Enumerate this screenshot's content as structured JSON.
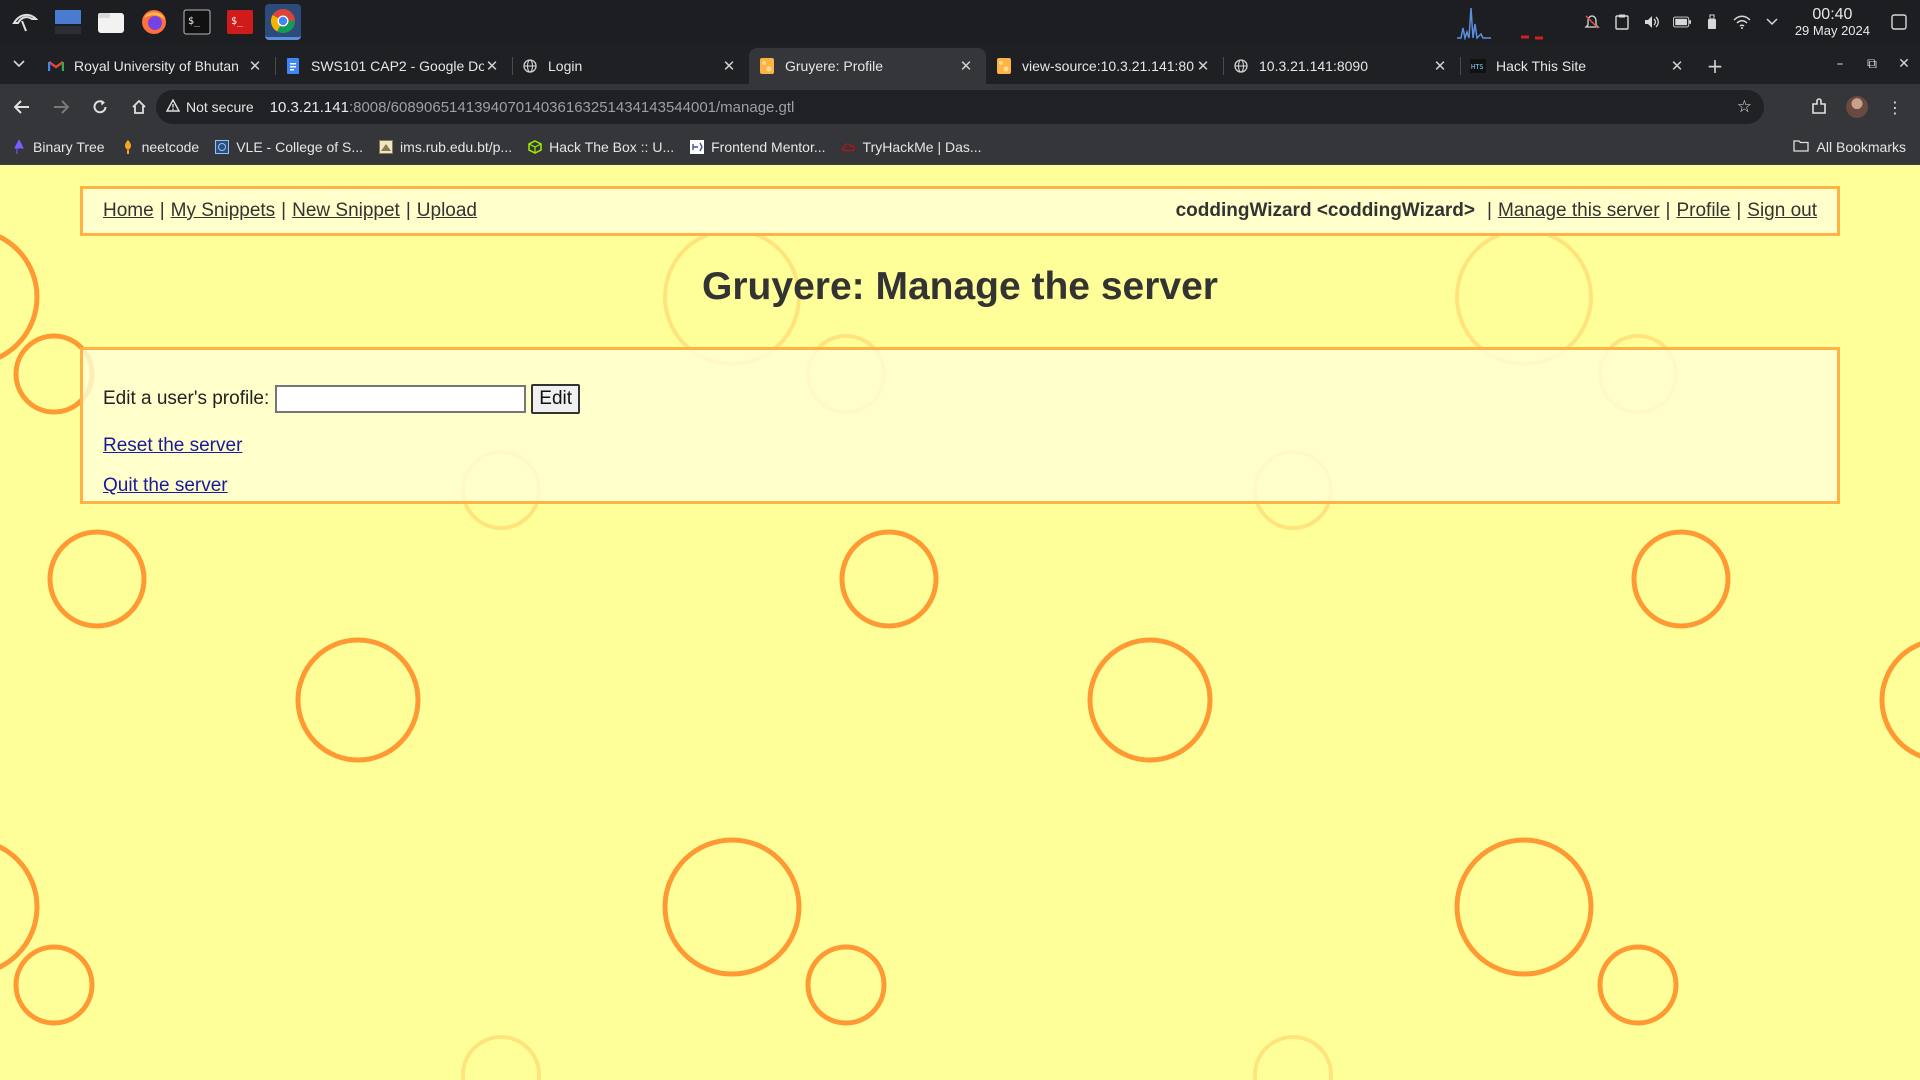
{
  "taskbar": {
    "apps": [
      "kali-menu-icon",
      "desktop-icon",
      "file-manager-icon",
      "firefox-icon",
      "terminal-icon",
      "root-terminal-icon",
      "chrome-icon"
    ],
    "clock_time": "00:40",
    "clock_date": "29 May 2024"
  },
  "tabs": [
    {
      "title": "Royal University of Bhutan",
      "icon": "gmail-icon",
      "active": false
    },
    {
      "title": "SWS101 CAP2 - Google Doc",
      "icon": "docs-icon",
      "active": false
    },
    {
      "title": "Login",
      "icon": "globe-icon",
      "active": false
    },
    {
      "title": "Gruyere: Profile",
      "icon": "gruyere-icon",
      "active": true
    },
    {
      "title": "view-source:10.3.21.141:80",
      "icon": "gruyere-icon",
      "active": false
    },
    {
      "title": "10.3.21.141:8090",
      "icon": "globe-icon",
      "active": false
    },
    {
      "title": "Hack This Site",
      "icon": "hts-icon",
      "active": false
    }
  ],
  "address": {
    "security_label": "Not secure",
    "url_host": "10.3.21.141",
    "url_rest": ":8008/608906514139407014036163251434143544001/manage.gtl"
  },
  "bookmarks": [
    {
      "label": "Binary Tree",
      "icon": "binary-tree-icon",
      "color": "#7b5cff"
    },
    {
      "label": "neetcode",
      "icon": "neetcode-icon",
      "color": "#f5a623"
    },
    {
      "label": "VLE - College of S...",
      "icon": "vle-icon",
      "color": "#6aa0d8"
    },
    {
      "label": "ims.rub.edu.bt/p...",
      "icon": "ims-icon",
      "color": "#c9c9c9"
    },
    {
      "label": "Hack The Box :: U...",
      "icon": "htb-icon",
      "color": "#9fef00"
    },
    {
      "label": "Frontend Mentor...",
      "icon": "frontend-mentor-icon",
      "color": "#ffffff"
    },
    {
      "label": "TryHackMe | Das...",
      "icon": "tryhackme-icon",
      "color": "#c11111"
    }
  ],
  "all_bookmarks_label": "All Bookmarks",
  "page": {
    "nav": {
      "home": "Home",
      "my_snippets": "My Snippets",
      "new_snippet": "New Snippet",
      "upload": "Upload",
      "user": "coddingWizard <coddingWizard>",
      "manage": "Manage this server",
      "profile": "Profile",
      "sign_out": "Sign out",
      "sep": "|"
    },
    "heading": "Gruyere: Manage the server",
    "edit_label": "Edit a user's profile:",
    "edit_value": "",
    "edit_button": "Edit",
    "reset_link": "Reset the server",
    "quit_link": "Quit the server"
  },
  "colors": {
    "page_bg": "#ffff99",
    "accent": "#ffb347",
    "circle": "#ff9933"
  }
}
